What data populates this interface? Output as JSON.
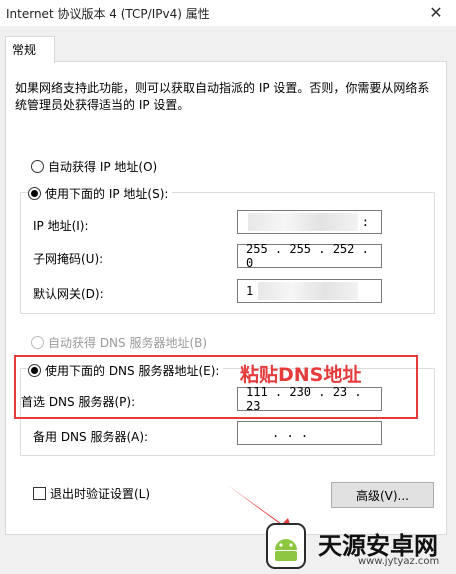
{
  "window": {
    "title": "Internet 协议版本 4 (TCP/IPv4) 属性",
    "close_glyph": "✕"
  },
  "tab": {
    "label": "常规"
  },
  "description": "如果网络支持此功能，则可以获取自动指派的 IP 设置。否则，你需要从网络系统管理员处获得适当的 IP 设置。",
  "ip": {
    "auto_label": "自动获得 IP 地址(O)",
    "manual_label": "使用下面的 IP 地址(S):",
    "ip_label": "IP 地址(I):",
    "ip_value": ":",
    "mask_label": "子网掩码(U):",
    "mask_value": "255 . 255 . 252 .  0",
    "gateway_label": "默认网关(D):",
    "gateway_value": "1"
  },
  "dns": {
    "auto_label": "自动获得 DNS 服务器地址(B)",
    "manual_label": "使用下面的 DNS 服务器地址(E):",
    "preferred_label": "首选 DNS 服务器(P):",
    "preferred_value": "111 . 230 .  23  .  23",
    "alternate_label": "备用 DNS 服务器(A):",
    "alternate_value": ".       .       ."
  },
  "validate_label": "退出时验证设置(L)",
  "advanced_label": "高级(V)...",
  "annotation": {
    "text": "粘贴DNS地址",
    "color": "#e53b3b"
  },
  "watermark": {
    "name": "天源安卓网",
    "url": "www.jytyaz.com"
  }
}
